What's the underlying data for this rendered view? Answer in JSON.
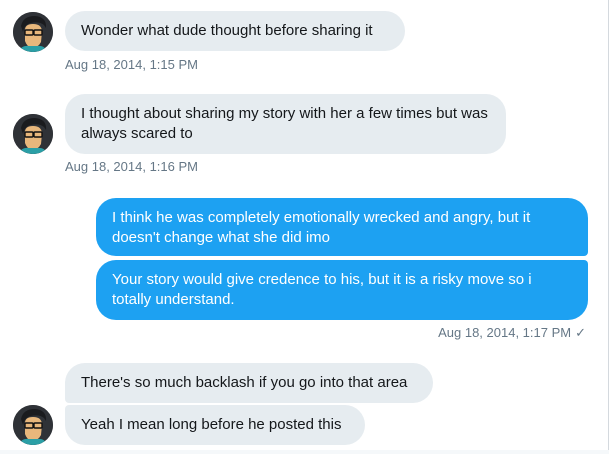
{
  "messages": [
    {
      "text": "Wonder what dude thought before sharing it",
      "timestamp": "Aug 18, 2014, 1:15 PM"
    },
    {
      "text": "I thought about sharing my story with her a few times but was always scared to",
      "timestamp": "Aug 18, 2014, 1:16 PM"
    },
    {
      "text": "I think he was completely emotionally wrecked and angry, but it doesn't change what she did imo"
    },
    {
      "text": "Your story would give credence to his, but it is a risky move so i totally understand.",
      "timestamp": "Aug 18, 2014, 1:17 PM",
      "status_icon": "✓"
    },
    {
      "text": "There's so much backlash if you go into that area"
    },
    {
      "text": "Yeah I mean long before he posted this"
    }
  ],
  "colors": {
    "incoming": "#e6ecf0",
    "outgoing": "#1da1f2",
    "timestamp": "#657786"
  }
}
